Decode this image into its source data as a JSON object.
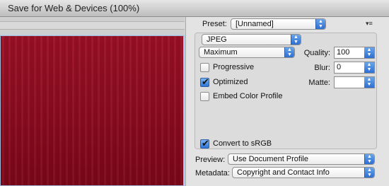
{
  "window": {
    "title": "Save for Web & Devices (100%)"
  },
  "preset": {
    "label": "Preset:",
    "value": "[Unnamed]"
  },
  "format": {
    "value": "JPEG"
  },
  "quality_preset": {
    "value": "Maximum"
  },
  "quality": {
    "label": "Quality:",
    "value": "100"
  },
  "blur": {
    "label": "Blur:",
    "value": "0"
  },
  "matte": {
    "label": "Matte:",
    "value": ""
  },
  "options": {
    "progressive": {
      "label": "Progressive",
      "checked": false
    },
    "optimized": {
      "label": "Optimized",
      "checked": true
    },
    "embed_color_profile": {
      "label": "Embed Color Profile",
      "checked": false
    },
    "convert_srgb": {
      "label": "Convert to sRGB",
      "checked": true
    }
  },
  "preview": {
    "label": "Preview:",
    "value": "Use Document Profile"
  },
  "metadata": {
    "label": "Metadata:",
    "value": "Copyright and Contact Info"
  },
  "icons": {
    "popup_arrows": "updown-arrows-icon",
    "panel_menu": "panel-menu-icon"
  },
  "colors": {
    "accent": "#2d6fd2",
    "image": "#8b0b1f"
  }
}
